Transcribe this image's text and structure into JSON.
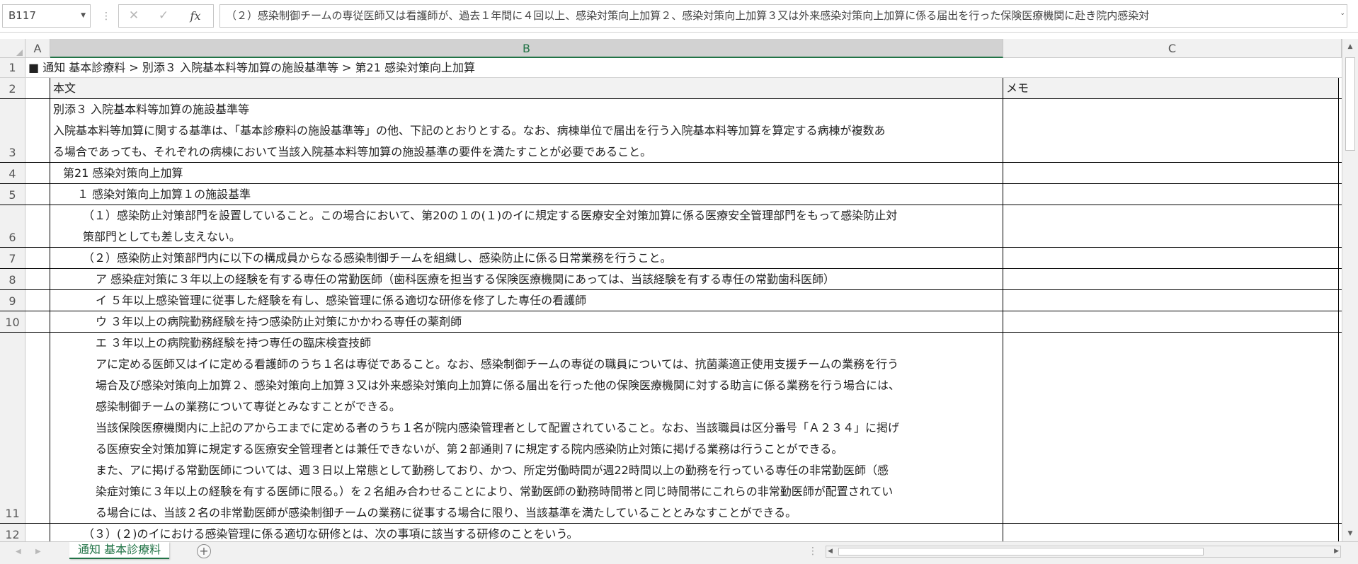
{
  "formula_bar": {
    "name_box": "B117",
    "cancel_icon": "✕",
    "enter_icon": "✓",
    "fx_label": "fx",
    "formula": "（２）感染制御チームの専従医師又は看護師が、過去１年間に４回以上、感染対策向上加算２、感染対策向上加算３又は外来感染対策向上加算に係る届出を行った保険医療機関に赴き院内感染対"
  },
  "columns": [
    "A",
    "B",
    "C"
  ],
  "active_column": "B",
  "rows": [
    {
      "num": "1",
      "b": [
        "■ 通知 基本診療料 > 別添３ 入院基本料等加算の施設基準等 > 第21 感染対策向上加算"
      ],
      "c": ""
    },
    {
      "num": "2",
      "b": [
        "本文"
      ],
      "c": "メモ"
    },
    {
      "num": "3",
      "b": [
        "別添３ 入院基本料等加算の施設基準等",
        "入院基本料等加算に関する基準は、「基本診療料の施設基準等」の他、下記のとおりとする。なお、病棟単位で届出を行う入院基本料等加算を算定する病棟が複数あ",
        "る場合であっても、それぞれの病棟において当該入院基本料等加算の施設基準の要件を満たすことが必要であること。"
      ],
      "c": ""
    },
    {
      "num": "4",
      "b": [
        "第21 感染対策向上加算"
      ],
      "c": ""
    },
    {
      "num": "5",
      "b": [
        "１ 感染対策向上加算１の施設基準"
      ],
      "c": ""
    },
    {
      "num": "6",
      "b": [
        "（１）感染防止対策部門を設置していること。この場合において、第20の１の(１)のイに規定する医療安全対策加算に係る医療安全管理部門をもって感染防止対",
        "策部門としても差し支えない。"
      ],
      "c": ""
    },
    {
      "num": "7",
      "b": [
        "（２）感染防止対策部門内に以下の構成員からなる感染制御チームを組織し、感染防止に係る日常業務を行うこと。"
      ],
      "c": ""
    },
    {
      "num": "8",
      "b": [
        "ア 感染症対策に３年以上の経験を有する専任の常勤医師（歯科医療を担当する保険医療機関にあっては、当該経験を有する専任の常勤歯科医師）"
      ],
      "c": ""
    },
    {
      "num": "9",
      "b": [
        "イ ５年以上感染管理に従事した経験を有し、感染管理に係る適切な研修を修了した専任の看護師"
      ],
      "c": ""
    },
    {
      "num": "10",
      "b": [
        "ウ ３年以上の病院勤務経験を持つ感染防止対策にかかわる専任の薬剤師"
      ],
      "c": ""
    },
    {
      "num": "11",
      "b": [
        "エ ３年以上の病院勤務経験を持つ専任の臨床検査技師",
        "アに定める医師又はイに定める看護師のうち１名は専従であること。なお、感染制御チームの専従の職員については、抗菌薬適正使用支援チームの業務を行う",
        "場合及び感染対策向上加算２、感染対策向上加算３又は外来感染対策向上加算に係る届出を行った他の保険医療機関に対する助言に係る業務を行う場合には、",
        "感染制御チームの業務について専従とみなすことができる。",
        "当該保険医療機関内に上記のアからエまでに定める者のうち１名が院内感染管理者として配置されていること。なお、当該職員は区分番号「Ａ２３４」に掲げ",
        "る医療安全対策加算に規定する医療安全管理者とは兼任できないが、第２部通則７に規定する院内感染防止対策に掲げる業務は行うことができる。",
        "また、アに掲げる常勤医師については、週３日以上常態として勤務しており、かつ、所定労働時間が週22時間以上の勤務を行っている専任の非常勤医師（感",
        "染症対策に３年以上の経験を有する医師に限る。）を２名組み合わせることにより、常勤医師の勤務時間帯と同じ時間帯にこれらの非常勤医師が配置されてい",
        "る場合には、当該２名の非常勤医師が感染制御チームの業務に従事する場合に限り、当該基準を満たしていることとみなすことができる。"
      ],
      "c": ""
    },
    {
      "num": "12",
      "b": [
        "（３）(２)のイにおける感染管理に係る適切な研修とは、次の事項に該当する研修のことをいう。"
      ],
      "c": ""
    }
  ],
  "sheet_tab": "通知 基本診療料",
  "add_sheet": "+"
}
